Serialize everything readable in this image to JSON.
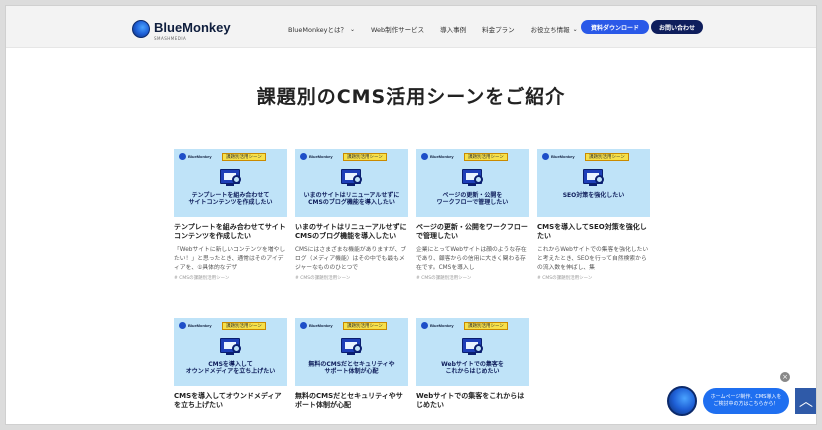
{
  "header": {
    "logo_text": "BlueMonkey",
    "logo_sub": "SMASHMEDIA",
    "nav": [
      {
        "label": "BlueMonkeyとは？",
        "has_dropdown": true
      },
      {
        "label": "Web制作サービス",
        "has_dropdown": false
      },
      {
        "label": "導入事例",
        "has_dropdown": false
      },
      {
        "label": "料金プラン",
        "has_dropdown": false
      },
      {
        "label": "お役立ち情報",
        "has_dropdown": true
      }
    ],
    "download_label": "資料ダウンロード",
    "contact_label": "お問い合わせ"
  },
  "main": {
    "title": "課題別のCMS活用シーンをご紹介",
    "cards": [
      {
        "brand": "BlueMonkey",
        "tag": "課題別活用シーン",
        "caption": "テンプレートを組み合わせて\nサイトコンテンツを作成したい",
        "title": "テンプレートを組み合わせてサイトコンテンツを作成したい",
        "desc": "「Webサイトに新しいコンテンツを増やしたい！」と思ったとき、通常はそのアイディアを、①具体的なデザ",
        "cat": "# CMSの課題別活用シーン"
      },
      {
        "brand": "BlueMonkey",
        "tag": "課題別活用シーン",
        "caption": "いまのサイトはリニューアルせずに\nCMSのブログ機能を導入したい",
        "title": "いまのサイトはリニューアルせずにCMSのブログ機能を導入したい",
        "desc": "CMSにはさまざまな機能がありますが、ブログ（メディア機能）はその中でも最もメジャーなもののひとつで",
        "cat": "# CMSの課題別活用シーン"
      },
      {
        "brand": "BlueMonkey",
        "tag": "課題別活用シーン",
        "caption": "ページの更新・公開を\nワークフローで管理したい",
        "title": "ページの更新・公開をワークフローで管理したい",
        "desc": "企業にとってWebサイトは顔のような存在であり、顧客からの信用に大きく関わる存在です。CMSを導入し",
        "cat": "# CMSの課題別活用シーン"
      },
      {
        "brand": "BlueMonkey",
        "tag": "課題別活用シーン",
        "caption": "SEO対策を強化したい",
        "title": "CMSを導入してSEO対策を強化したい",
        "desc": "これからWebサイトでの集客を強化したいと考えたとき、SEOを行って自然検索からの流入数を伸ばし、集",
        "cat": "# CMSの課題別活用シーン"
      },
      {
        "brand": "BlueMonkey",
        "tag": "課題別活用シーン",
        "caption": "CMSを導入して\nオウンドメディアを立ち上げたい",
        "title": "CMSを導入してオウンドメディアを立ち上げたい",
        "desc": "",
        "cat": ""
      },
      {
        "brand": "BlueMonkey",
        "tag": "課題別活用シーン",
        "caption": "無料のCMSだとセキュリティや\nサポート体制が心配",
        "title": "無料のCMSだとセキュリティやサポート体制が心配",
        "desc": "",
        "cat": ""
      },
      {
        "brand": "BlueMonkey",
        "tag": "課題別活用シーン",
        "caption": "Webサイトでの集客を\nこれからはじめたい",
        "title": "Webサイトでの集客をこれからはじめたい",
        "desc": "",
        "cat": ""
      }
    ]
  },
  "chat": {
    "bubble_text": "ホームページ制作、CMS導入をご検討中の方はこちらから！",
    "close_glyph": "×",
    "scroll_top_glyph": "︿"
  }
}
